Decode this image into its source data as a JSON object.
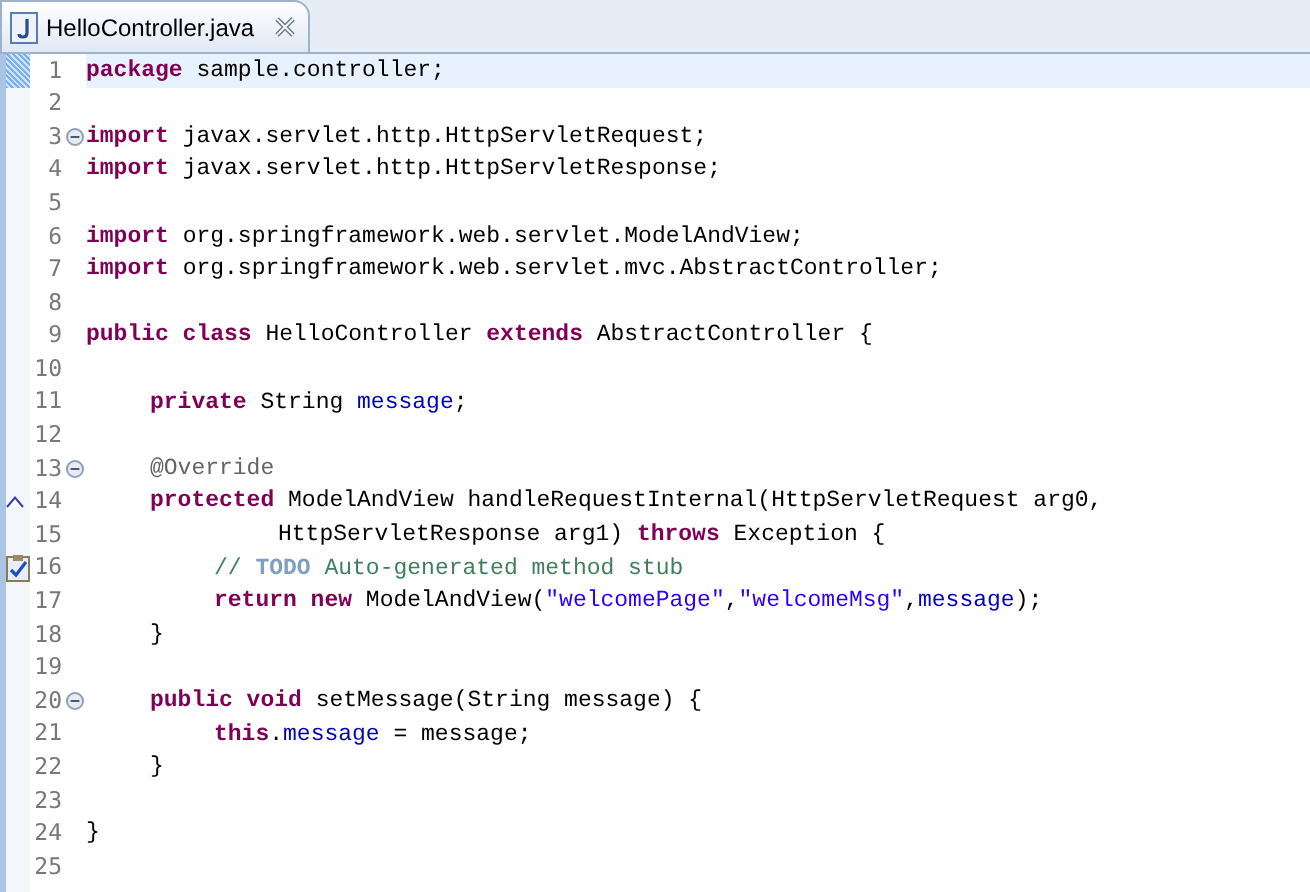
{
  "tab": {
    "title": "HelloController.java",
    "selected": true
  },
  "lines": [
    {
      "number": "1",
      "current": true,
      "kind": "code",
      "tokens": [
        {
          "kind": "keyword",
          "text": "package"
        },
        {
          "kind": "plain",
          "text": " sample.controller;"
        }
      ]
    },
    {
      "number": "2",
      "current": false,
      "kind": "code"
    },
    {
      "number": "3",
      "current": false,
      "kind": "fold",
      "tokens": [
        {
          "kind": "keyword",
          "text": "import"
        },
        {
          "kind": "plain",
          "text": " javax.servlet.http.HttpServletRequest;"
        }
      ]
    },
    {
      "number": "4",
      "current": false,
      "kind": "code",
      "tokens": [
        {
          "kind": "keyword",
          "text": "import"
        },
        {
          "kind": "plain",
          "text": " javax.servlet.http.HttpServletResponse;"
        }
      ]
    },
    {
      "number": "5",
      "current": false,
      "kind": "code"
    },
    {
      "number": "6",
      "current": false,
      "kind": "code",
      "tokens": [
        {
          "kind": "keyword",
          "text": "import"
        },
        {
          "kind": "plain",
          "text": " org.springframework.web.servlet.ModelAndView;"
        }
      ]
    },
    {
      "number": "7",
      "current": false,
      "kind": "code",
      "tokens": [
        {
          "kind": "keyword",
          "text": "import"
        },
        {
          "kind": "plain",
          "text": " org.springframework.web.servlet.mvc.AbstractController;"
        }
      ]
    },
    {
      "number": "8",
      "current": false,
      "kind": "code"
    },
    {
      "number": "9",
      "current": false,
      "kind": "code",
      "tokens": [
        {
          "kind": "keyword",
          "text": "public class"
        },
        {
          "kind": "plain",
          "text": " HelloController "
        },
        {
          "kind": "keyword",
          "text": "extends"
        },
        {
          "kind": "plain",
          "text": " AbstractController {"
        }
      ]
    },
    {
      "number": "10",
      "current": false,
      "kind": "code"
    },
    {
      "number": "11",
      "current": false,
      "kind": "code",
      "tokens": [
        {
          "kind": "keyword",
          "text": "\tprivate"
        },
        {
          "kind": "plain",
          "text": " String "
        },
        {
          "kind": "field",
          "text": "message"
        },
        {
          "kind": "plain",
          "text": ";"
        }
      ]
    },
    {
      "number": "12",
      "current": false,
      "kind": "code"
    },
    {
      "number": "13",
      "current": false,
      "kind": "fold",
      "tokens": [
        {
          "kind": "annotation",
          "text": "\t@Override"
        }
      ]
    },
    {
      "number": "14",
      "current": false,
      "kind": "override",
      "tokens": [
        {
          "kind": "keyword",
          "text": "\tprotected"
        },
        {
          "kind": "plain",
          "text": " ModelAndView handleRequestInternal(HttpServletRequest arg0,"
        }
      ]
    },
    {
      "number": "15",
      "current": false,
      "kind": "code",
      "tokens": [
        {
          "kind": "plain",
          "text": "\t\t\tHttpServletResponse arg1) "
        },
        {
          "kind": "keyword",
          "text": "throws"
        },
        {
          "kind": "plain",
          "text": " Exception {"
        }
      ]
    },
    {
      "number": "16",
      "current": false,
      "kind": "task",
      "tokens": [
        {
          "kind": "comment",
          "text": "\t\t// "
        },
        {
          "kind": "todo",
          "text": "TODO"
        },
        {
          "kind": "comment",
          "text": " Auto-generated method stub"
        }
      ]
    },
    {
      "number": "17",
      "current": false,
      "kind": "code",
      "tokens": [
        {
          "kind": "keyword",
          "text": "\t\treturn new"
        },
        {
          "kind": "plain",
          "text": " ModelAndView("
        },
        {
          "kind": "string",
          "text": "\"welcomePage\""
        },
        {
          "kind": "plain",
          "text": ","
        },
        {
          "kind": "string",
          "text": "\"welcomeMsg\""
        },
        {
          "kind": "plain",
          "text": ","
        },
        {
          "kind": "field",
          "text": "message"
        },
        {
          "kind": "plain",
          "text": ");"
        }
      ]
    },
    {
      "number": "18",
      "current": false,
      "kind": "code",
      "tokens": [
        {
          "kind": "plain",
          "text": "\t}"
        }
      ]
    },
    {
      "number": "19",
      "current": false,
      "kind": "code"
    },
    {
      "number": "20",
      "current": false,
      "kind": "fold",
      "tokens": [
        {
          "kind": "keyword",
          "text": "\tpublic void"
        },
        {
          "kind": "plain",
          "text": " setMessage(String message) {"
        }
      ]
    },
    {
      "number": "21",
      "current": false,
      "kind": "code",
      "tokens": [
        {
          "kind": "keyword",
          "text": "\t\tthis"
        },
        {
          "kind": "plain",
          "text": "."
        },
        {
          "kind": "field",
          "text": "message"
        },
        {
          "kind": "plain",
          "text": " = message;"
        }
      ]
    },
    {
      "number": "22",
      "current": false,
      "kind": "code",
      "tokens": [
        {
          "kind": "plain",
          "text": "\t}"
        }
      ]
    },
    {
      "number": "23",
      "current": false,
      "kind": "code"
    },
    {
      "number": "24",
      "current": false,
      "kind": "code",
      "tokens": [
        {
          "kind": "plain",
          "text": "}"
        }
      ]
    },
    {
      "number": "25",
      "current": false,
      "kind": "code"
    }
  ]
}
